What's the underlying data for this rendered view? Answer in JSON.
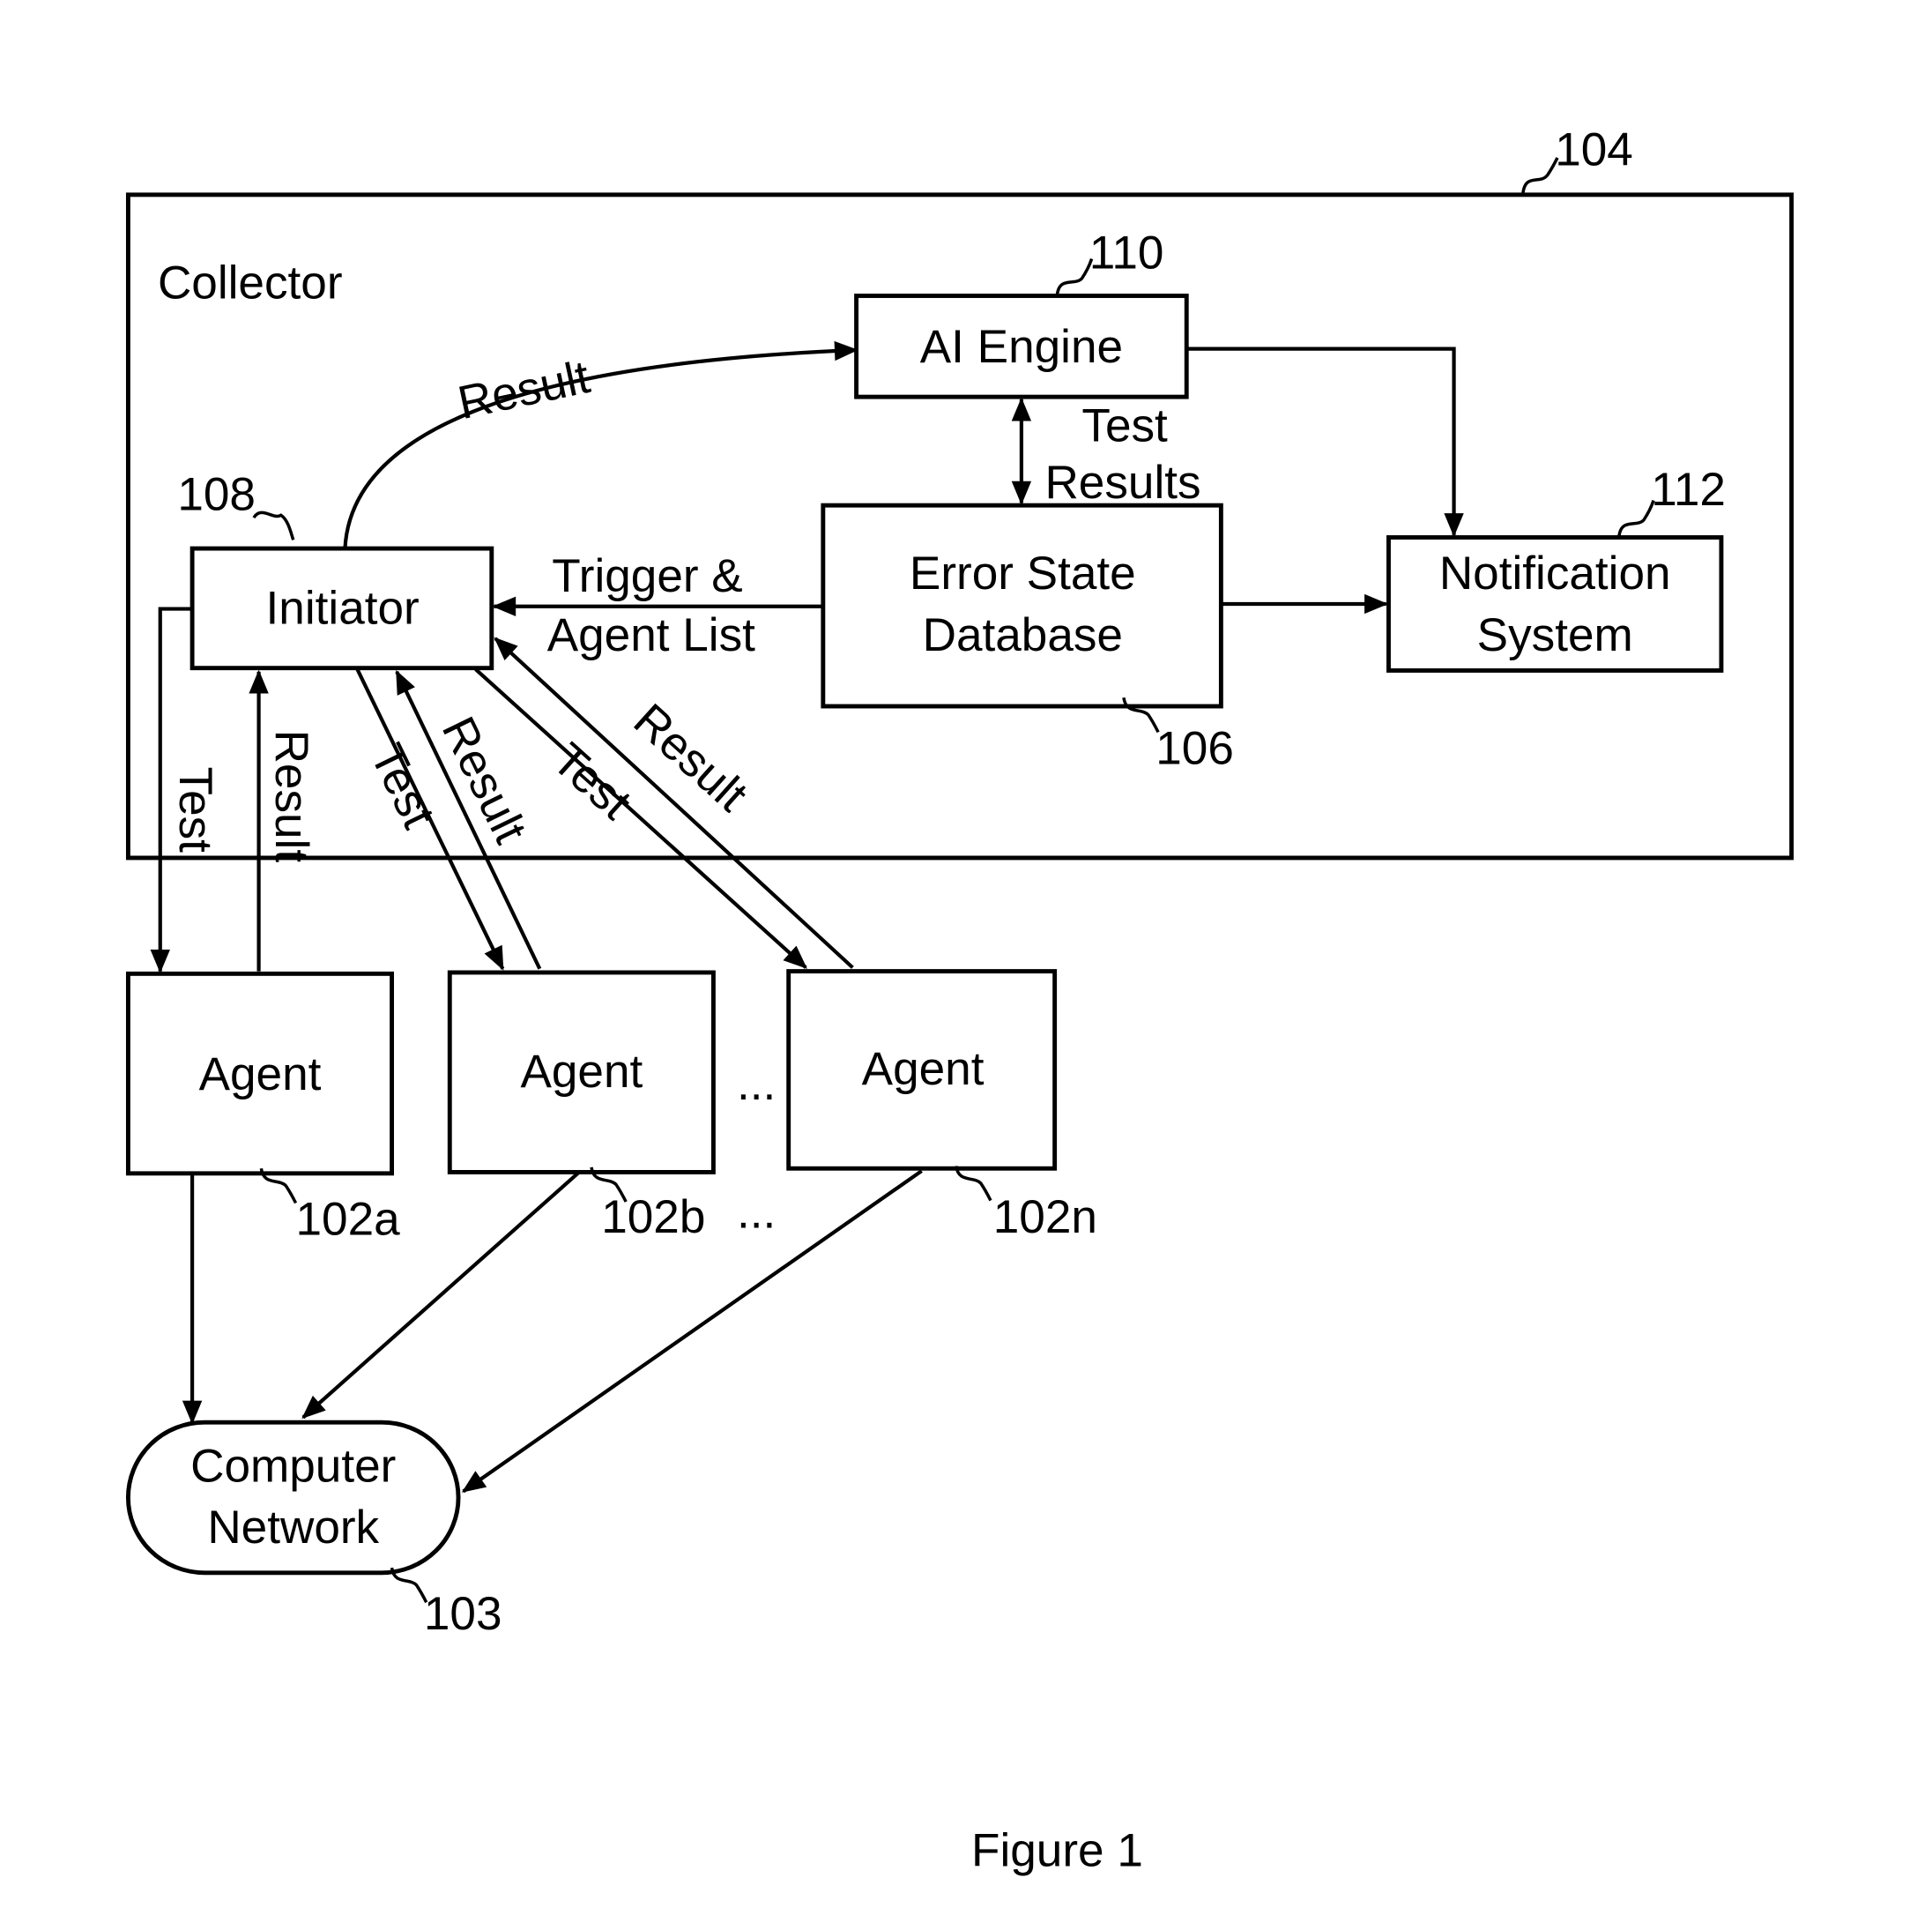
{
  "figure": {
    "caption": "Figure 1",
    "collector": {
      "label": "Collector",
      "ref": "104"
    },
    "ai_engine": {
      "label": "AI Engine",
      "ref": "110"
    },
    "error_db": {
      "line1": "Error State",
      "line2": "Database",
      "ref": "106"
    },
    "notification": {
      "line1": "Notification",
      "line2": "System",
      "ref": "112"
    },
    "initiator": {
      "label": "Initiator",
      "ref": "108"
    },
    "agents": [
      {
        "label": "Agent",
        "ref": "102a"
      },
      {
        "label": "Agent",
        "ref": "102b"
      },
      {
        "label": "Agent",
        "ref": "102n"
      }
    ],
    "ellipsis": "...",
    "network": {
      "line1": "Computer",
      "line2": "Network",
      "ref": "103"
    },
    "edge_labels": {
      "result_to_ai": "Result",
      "test_results_1": "Test",
      "test_results_2": "Results",
      "trigger_1": "Trigger &",
      "trigger_2": "Agent List",
      "test": "Test",
      "result": "Result"
    }
  }
}
